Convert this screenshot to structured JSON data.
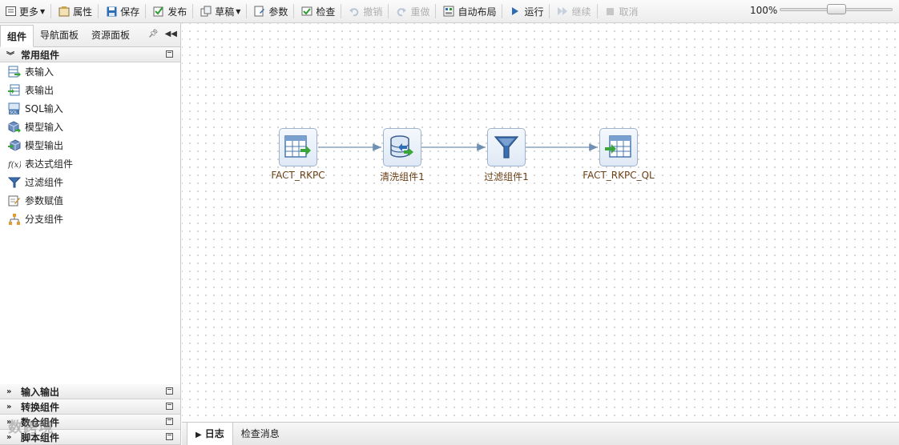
{
  "toolbar": {
    "more": "更多",
    "properties": "属性",
    "save": "保存",
    "publish": "发布",
    "draft": "草稿",
    "params": "参数",
    "check": "检查",
    "undo": "撤销",
    "redo": "重做",
    "auto_layout": "自动布局",
    "run": "运行",
    "continue": "继续",
    "cancel": "取消",
    "zoom": "100%",
    "zoom_level": 0.45
  },
  "left_panel": {
    "tabs": [
      "组件",
      "导航面板",
      "资源面板"
    ],
    "active_group": "常用组件",
    "items": [
      "表输入",
      "表输出",
      "SQL输入",
      "模型输入",
      "模型输出",
      "表达式组件",
      "过滤组件",
      "参数赋值",
      "分支组件"
    ],
    "bottom_groups": [
      "输入输出",
      "转换组件",
      "数仓组件",
      "脚本组件"
    ]
  },
  "flow": {
    "nodes": [
      {
        "label": "FACT_RKPC",
        "icon": "table-input-icon"
      },
      {
        "label": "清洗组件1",
        "icon": "database-clean-icon"
      },
      {
        "label": "过滤组件1",
        "icon": "funnel-filter-icon"
      },
      {
        "label": "FACT_RKPC_QL",
        "icon": "table-output-icon"
      }
    ]
  },
  "bottom_tabs": [
    "日志",
    "检查消息"
  ],
  "watermark": "数跨境",
  "colors": {
    "accent": "#2e6db4",
    "node_border": "#9fb4cc",
    "node_label": "#6b3f14",
    "arrow": "#6f8fb5"
  }
}
